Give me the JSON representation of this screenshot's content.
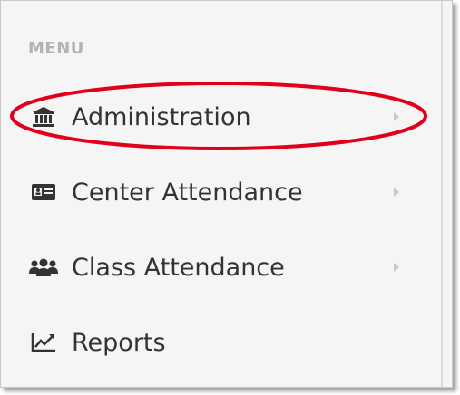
{
  "menu": {
    "header": "MENU",
    "items": [
      {
        "label": "Administration",
        "icon": "bank-icon",
        "has_submenu": true
      },
      {
        "label": "Center Attendance",
        "icon": "id-card-icon",
        "has_submenu": true
      },
      {
        "label": "Class Attendance",
        "icon": "users-icon",
        "has_submenu": true
      },
      {
        "label": "Reports",
        "icon": "line-chart-icon",
        "has_submenu": false
      }
    ]
  },
  "colors": {
    "text": "#333333",
    "header": "#b3b3b3",
    "background": "#f5f5f5",
    "annotation": "#e0001b"
  }
}
